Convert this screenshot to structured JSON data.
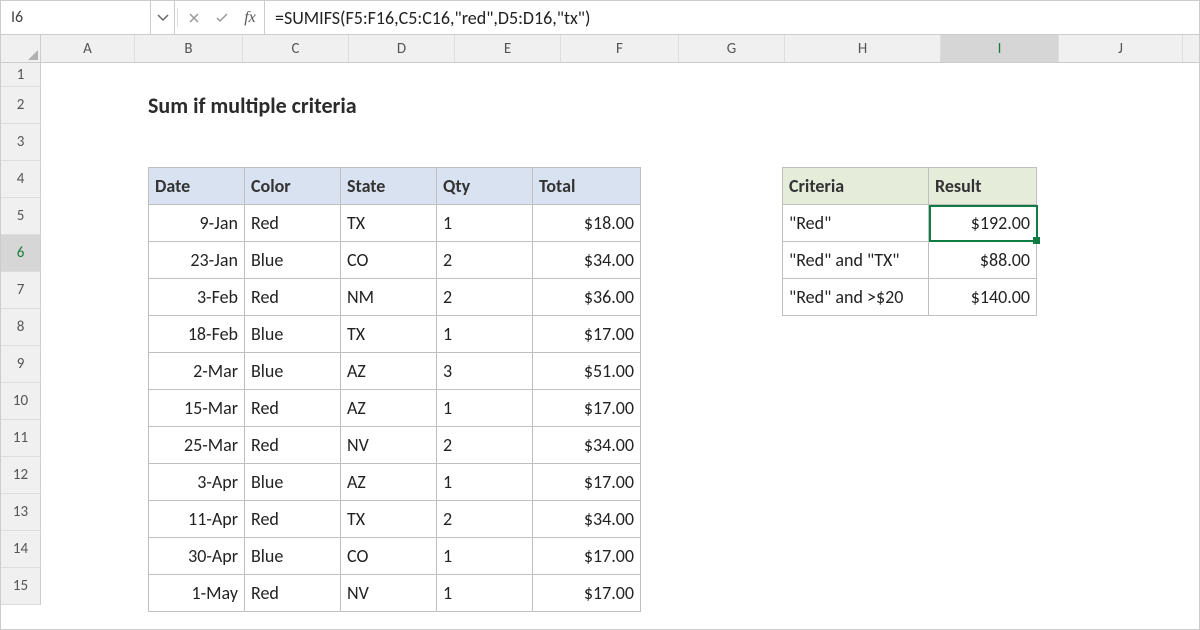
{
  "namebox": {
    "value": "I6"
  },
  "formula_bar": {
    "formula": "=SUMIFS(F5:F16,C5:C16,\"red\",D5:D16,\"tx\")"
  },
  "columns": [
    "A",
    "B",
    "C",
    "D",
    "E",
    "F",
    "G",
    "H",
    "I",
    "J"
  ],
  "active_column": "I",
  "rows": [
    1,
    2,
    3,
    4,
    5,
    6,
    7,
    8,
    9,
    10,
    11,
    12,
    13,
    14,
    15
  ],
  "active_row": 6,
  "title": "Sum if multiple criteria",
  "main_table": {
    "headers": {
      "date": "Date",
      "color": "Color",
      "state": "State",
      "qty": "Qty",
      "total": "Total"
    },
    "rows": [
      {
        "date": "9-Jan",
        "color": "Red",
        "state": "TX",
        "qty": "1",
        "total": "$18.00"
      },
      {
        "date": "23-Jan",
        "color": "Blue",
        "state": "CO",
        "qty": "2",
        "total": "$34.00"
      },
      {
        "date": "3-Feb",
        "color": "Red",
        "state": "NM",
        "qty": "2",
        "total": "$36.00"
      },
      {
        "date": "18-Feb",
        "color": "Blue",
        "state": "TX",
        "qty": "1",
        "total": "$17.00"
      },
      {
        "date": "2-Mar",
        "color": "Blue",
        "state": "AZ",
        "qty": "3",
        "total": "$51.00"
      },
      {
        "date": "15-Mar",
        "color": "Red",
        "state": "AZ",
        "qty": "1",
        "total": "$17.00"
      },
      {
        "date": "25-Mar",
        "color": "Red",
        "state": "NV",
        "qty": "2",
        "total": "$34.00"
      },
      {
        "date": "3-Apr",
        "color": "Blue",
        "state": "AZ",
        "qty": "1",
        "total": "$17.00"
      },
      {
        "date": "11-Apr",
        "color": "Red",
        "state": "TX",
        "qty": "2",
        "total": "$34.00"
      },
      {
        "date": "30-Apr",
        "color": "Blue",
        "state": "CO",
        "qty": "1",
        "total": "$17.00"
      },
      {
        "date": "1-May",
        "color": "Red",
        "state": "NV",
        "qty": "1",
        "total": "$17.00"
      }
    ]
  },
  "criteria_table": {
    "headers": {
      "criteria": "Criteria",
      "result": "Result"
    },
    "rows": [
      {
        "criteria": "\"Red\"",
        "result": "$192.00"
      },
      {
        "criteria": "\"Red\" and \"TX\"",
        "result": "$88.00"
      },
      {
        "criteria": "\"Red\" and >$20",
        "result": "$140.00"
      }
    ]
  },
  "icons": {
    "chevron_down": "chevron-down-icon",
    "cancel": "cancel-icon",
    "confirm": "confirm-icon",
    "fx": "fx-icon"
  }
}
